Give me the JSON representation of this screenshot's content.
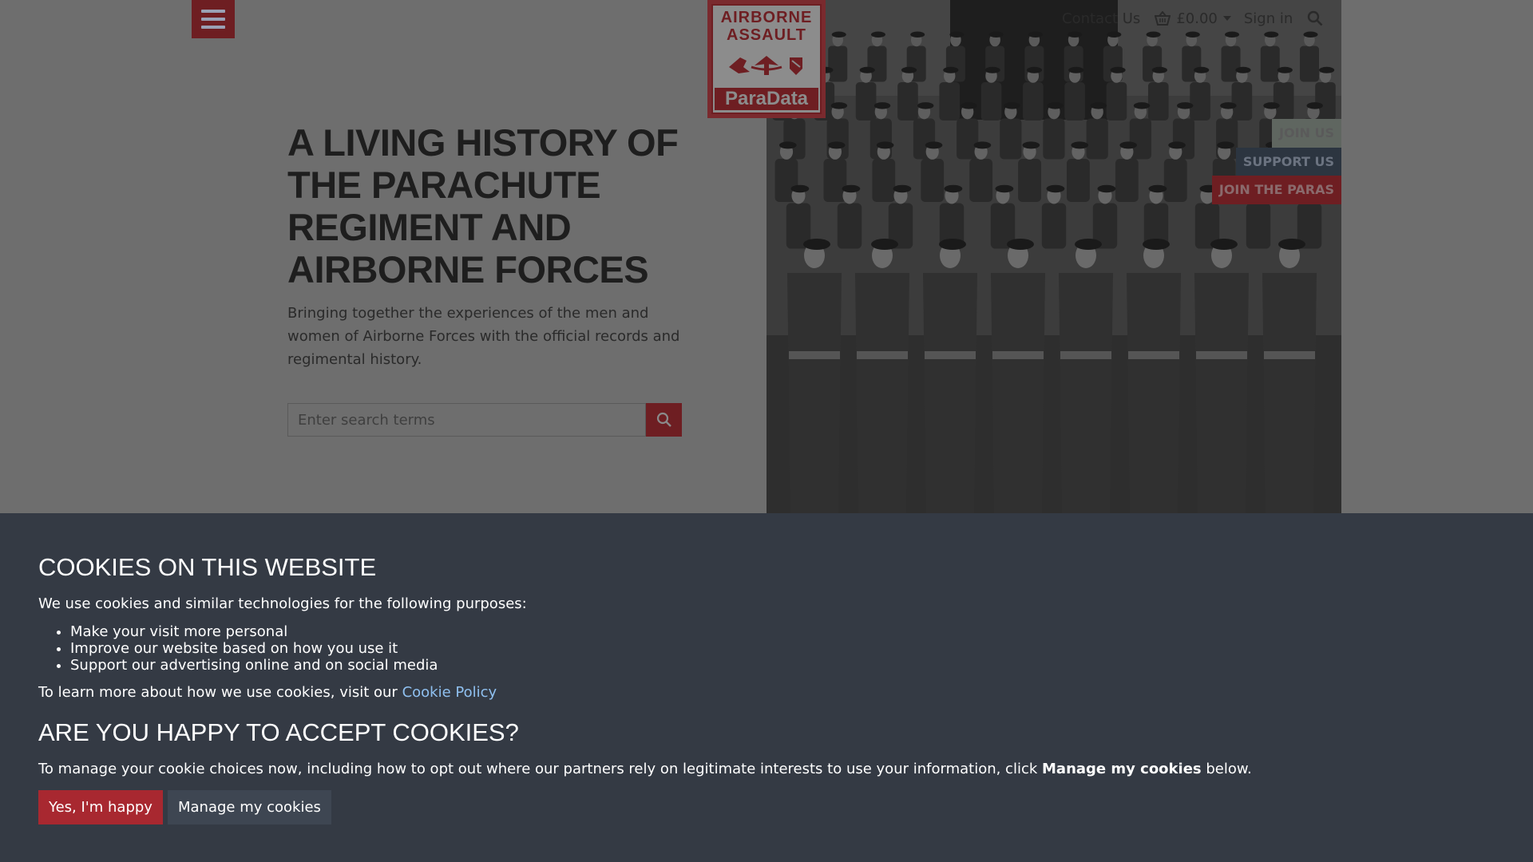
{
  "header": {
    "menu_icon": "hamburger-icon",
    "logo": {
      "line1": "AIRBORNE",
      "line2": "ASSAULT",
      "wordmark": "ParaData"
    },
    "nav": {
      "contact": "Contact Us",
      "basket_icon": "basket-icon",
      "basket_total": "£0.00",
      "dropdown_icon": "caret-down-icon",
      "signin": "Sign in",
      "search_icon": "search-icon"
    }
  },
  "side_buttons": {
    "join_us": "JOIN US",
    "support_us": "SUPPORT US",
    "join_paras": "JOIN THE PARAS"
  },
  "hero": {
    "title": "A LIVING HISTORY OF THE PARACHUTE REGIMENT AND AIRBORNE FORCES",
    "subtitle": "Bringing together the experiences of the men and women of Airborne Forces with the official records and regimental history.",
    "search_placeholder": "Enter search terms",
    "search_button_icon": "search-icon"
  },
  "cookie_banner": {
    "heading": "COOKIES ON THIS WEBSITE",
    "intro": "We use cookies and similar technologies for the following purposes:",
    "purposes": [
      "Make your visit more personal",
      "Improve our website based on how you use it",
      "Support our advertising online and on social media"
    ],
    "learn_more_text": "To learn more about how we use cookies, visit our",
    "policy_link": "Cookie Policy",
    "question": "ARE YOU HAPPY TO ACCEPT COOKIES?",
    "manage_text_before": "To manage your cookie choices now, including how to opt out where our partners rely on legitimate interests to use your information, click",
    "manage_text_bold": "Manage my cookies",
    "manage_text_after": "below.",
    "accept_label": "Yes, I'm happy",
    "manage_label": "Manage my cookies"
  },
  "colors": {
    "brand_maroon": "#6e1e22",
    "banner_bg": "#343a44",
    "accept_button": "#a82830",
    "link": "#8fc0f0"
  }
}
